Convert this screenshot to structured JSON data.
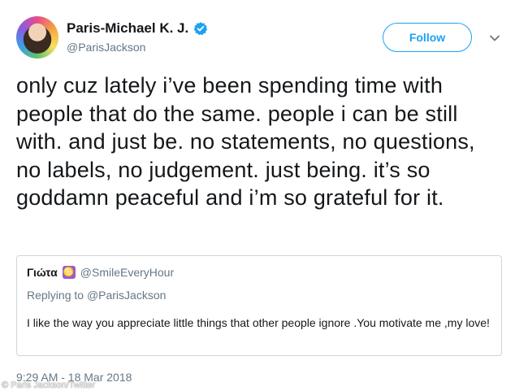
{
  "user": {
    "display_name": "Paris-Michael K. J.",
    "handle": "@ParisJackson",
    "verified": true
  },
  "actions": {
    "follow_label": "Follow"
  },
  "tweet": {
    "text": "only cuz lately i’ve been spending time with people that do the same. people i can be still with. and just be. no statements, no questions, no labels, no judgement. just being. it’s so goddamn peaceful and i’m so grateful for it.",
    "timestamp": "9:29 AM - 18 Mar 2018"
  },
  "quoted": {
    "name": "Γιώτα",
    "emoji": "♋",
    "handle": "@SmileEveryHour",
    "replying_prefix": "Replying to ",
    "replying_handle": "@ParisJackson",
    "text": "I like the way you appreciate little things that other people ignore .You motivate me ,my love!"
  },
  "watermark": "© Paris Jackson/Twitter",
  "colors": {
    "accent": "#1da1f2",
    "secondary_text": "#657786",
    "border": "#ccd6dd",
    "primary_text": "#14171a"
  }
}
